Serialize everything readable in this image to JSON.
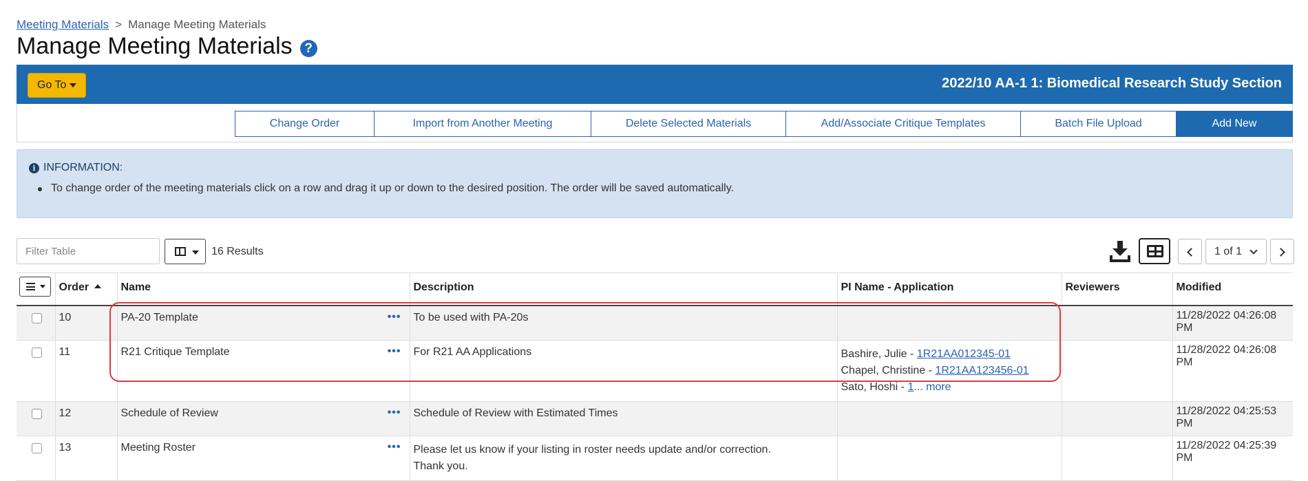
{
  "breadcrumb": {
    "link": "Meeting Materials",
    "separator": ">",
    "current": "Manage Meeting Materials"
  },
  "page": {
    "title": "Manage Meeting Materials",
    "help_icon": "?"
  },
  "header_bar": {
    "goto_label": "Go To",
    "meeting_title": "2022/10 AA-1 1: Biomedical Research Study Section"
  },
  "actions": [
    {
      "label": "Change Order"
    },
    {
      "label": "Import from Another Meeting"
    },
    {
      "label": "Delete Selected Materials"
    },
    {
      "label": "Add/Associate Critique Templates"
    },
    {
      "label": "Batch File Upload"
    },
    {
      "label": "Add New"
    }
  ],
  "info": {
    "icon": "i",
    "heading": "INFORMATION:",
    "items": [
      "To change order of the meeting materials click on a row and drag it up or down to the desired position. The order will be saved automatically."
    ]
  },
  "toolbar": {
    "filter_placeholder": "Filter Table",
    "results": "16 Results",
    "page_select": "1 of 1"
  },
  "table": {
    "columns": [
      "Order",
      "Name",
      "Description",
      "PI Name - Application",
      "Reviewers",
      "Modified"
    ],
    "row_menu": "•••",
    "rows": [
      {
        "order": "10",
        "name": "PA-20 Template",
        "description": "To be used with PA-20s",
        "pi": [],
        "reviewers": "",
        "modified": "11/28/2022 04:26:08 PM"
      },
      {
        "order": "11",
        "name": "R21 Critique Template",
        "description": "For R21 AA Applications",
        "pi": [
          {
            "name": "Bashire, Julie - ",
            "app": "1R21AA012345-01"
          },
          {
            "name": "Chapel, Christine - ",
            "app": "1R21AA123456-01"
          },
          {
            "name": "Sato, Hoshi - ",
            "app": "1",
            "more": "... more"
          }
        ],
        "reviewers": "",
        "modified": "11/28/2022 04:26:08 PM"
      },
      {
        "order": "12",
        "name": "Schedule of Review",
        "description": "Schedule of Review with Estimated Times",
        "pi": [],
        "reviewers": "",
        "modified": "11/28/2022 04:25:53 PM"
      },
      {
        "order": "13",
        "name": "Meeting Roster",
        "description": "Please let us know if your listing in roster needs update and/or correction.",
        "description2": "Thank you.",
        "pi": [],
        "reviewers": "",
        "modified": "11/28/2022 04:25:39 PM"
      }
    ]
  }
}
